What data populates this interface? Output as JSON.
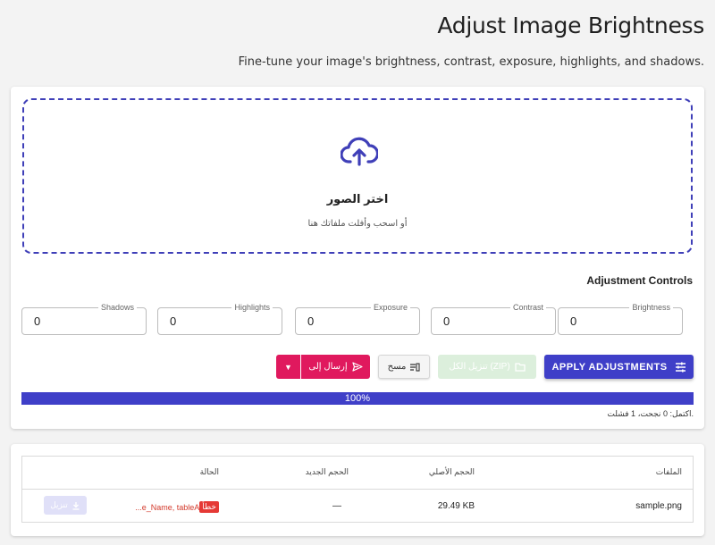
{
  "header": {
    "title": "Adjust Image Brightness",
    "subtitle": "Fine-tune your image's brightness, contrast, exposure, highlights, and shadows."
  },
  "dropzone": {
    "title": "اختر الصور",
    "hint": "أو اسحب وأفلت ملفاتك هنا"
  },
  "controls": {
    "title": "Adjustment Controls",
    "fields": [
      {
        "label": "Brightness",
        "value": "0"
      },
      {
        "label": "Contrast",
        "value": "0"
      },
      {
        "label": "Exposure",
        "value": "0"
      },
      {
        "label": "Highlights",
        "value": "0"
      },
      {
        "label": "Shadows",
        "value": "0"
      }
    ]
  },
  "actions": {
    "apply_label": "APPLY ADJUSTMENTS",
    "zip_label": "تنزيل الكل (ZIP)",
    "clear_label": "مسح",
    "send_label": "إرسال إلى"
  },
  "progress": {
    "percent": 100,
    "label": "100%",
    "status": "اكتمل: 0 نجحت، 1 فشلت."
  },
  "table": {
    "headers": {
      "files": "الملفات",
      "original_size": "الحجم الأصلي",
      "new_size": "الحجم الجديد",
      "status": "الحالة"
    },
    "rows": [
      {
        "file": "sample.png",
        "original_size": "29.49 KB",
        "new_size": "—",
        "status_badge": "خطأ",
        "status_text": "...e_Name, tableA",
        "download_label": "تنزيل"
      }
    ]
  },
  "colors": {
    "primary": "#3f3fc8",
    "send": "#e0195e",
    "zip_disabled": "#dcefdc",
    "error": "#e53935"
  }
}
